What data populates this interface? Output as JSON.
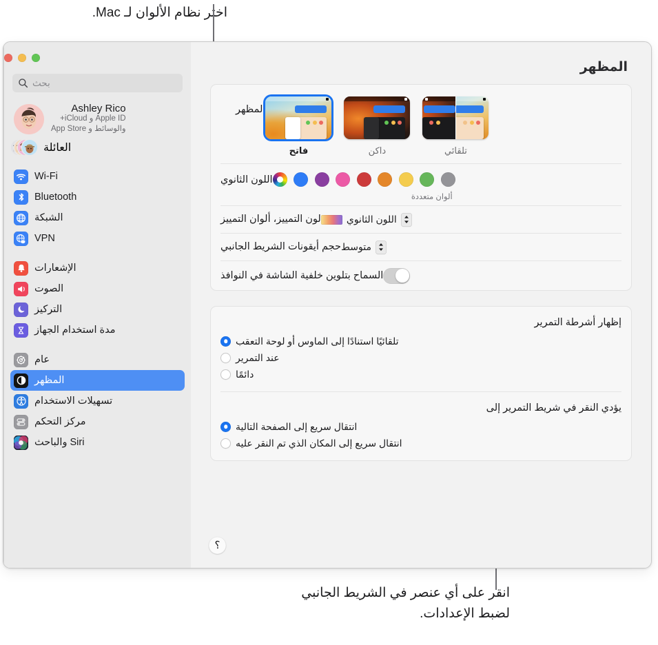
{
  "callouts": {
    "top": "اختر نظام الألوان لـ Mac.",
    "bottom": "انقر على أي عنصر في الشريط الجانبي لضبط الإعدادات."
  },
  "window": {
    "title": "المظهر",
    "traffic_lights": [
      "close",
      "minimize",
      "maximize"
    ]
  },
  "sidebar": {
    "search": {
      "placeholder": "بحث",
      "icon": "search-icon"
    },
    "account": {
      "name": "Ashley Rico",
      "subtitle_line1": "Apple ID و iCloud+",
      "subtitle_line2": "والوسائط و App Store",
      "avatar": "memoji-avatar"
    },
    "family": {
      "label": "العائلة",
      "icon": "family-avatars"
    },
    "groups": [
      {
        "items": [
          {
            "label": "Wi-Fi",
            "icon": "wifi-icon",
            "color": "#3b82f6",
            "selected": false
          },
          {
            "label": "Bluetooth",
            "icon": "bluetooth-icon",
            "color": "#3b82f6",
            "selected": false
          },
          {
            "label": "الشبكة",
            "icon": "globe-icon",
            "color": "#3b82f6",
            "selected": false
          },
          {
            "label": "VPN",
            "icon": "vpn-globe-icon",
            "color": "#3b82f6",
            "selected": false
          }
        ]
      },
      {
        "items": [
          {
            "label": "الإشعارات",
            "icon": "bell-icon",
            "color": "#f0503f",
            "selected": false
          },
          {
            "label": "الصوت",
            "icon": "speaker-icon",
            "color": "#f0455c",
            "selected": false
          },
          {
            "label": "التركيز",
            "icon": "moon-icon",
            "color": "#6c63d8",
            "selected": false
          },
          {
            "label": "مدة استخدام الجهاز",
            "icon": "hourglass-icon",
            "color": "#6b5de0",
            "selected": false
          }
        ]
      },
      {
        "items": [
          {
            "label": "عام",
            "icon": "gear-icon",
            "color": "#9a9a9e",
            "selected": false
          },
          {
            "label": "المظهر",
            "icon": "appearance-icon",
            "color": "#1a1a1a",
            "selected": true
          },
          {
            "label": "تسهيلات الاستخدام",
            "icon": "accessibility-icon",
            "color": "#2f7de0",
            "selected": false
          },
          {
            "label": "مركز التحكم",
            "icon": "control-center-icon",
            "color": "#9a9a9e",
            "selected": false
          },
          {
            "label": "Siri والباحث",
            "icon": "siri-icon",
            "color": "#25273a",
            "selected": false
          }
        ]
      }
    ]
  },
  "main": {
    "appearance_card": {
      "theme_row": {
        "label": "المظهر",
        "options": [
          {
            "caption": "فاتح",
            "value": "light",
            "selected": true
          },
          {
            "caption": "داكن",
            "value": "dark",
            "selected": false
          },
          {
            "caption": "تلقائي",
            "value": "auto",
            "selected": false
          }
        ]
      },
      "accent_row": {
        "label": "اللون الثانوي",
        "caption": "ألوان متعددة",
        "swatches": [
          {
            "name": "multicolor",
            "color": "wheel",
            "selected": true
          },
          {
            "name": "blue",
            "color": "#2e7cf6"
          },
          {
            "name": "purple",
            "color": "#8a3fa0"
          },
          {
            "name": "pink",
            "color": "#ec5aa6"
          },
          {
            "name": "red",
            "color": "#cc3b3b"
          },
          {
            "name": "orange",
            "color": "#e4872a"
          },
          {
            "name": "yellow",
            "color": "#f4cc4e"
          },
          {
            "name": "green",
            "color": "#66b65a"
          },
          {
            "name": "graphite",
            "color": "#949498"
          }
        ]
      },
      "highlight_row": {
        "label": "لون التمييز، ألوان التمييز",
        "value": "اللون الثانوي"
      },
      "sidebar_icon_row": {
        "label": "حجم أيقونات الشريط الجانبي",
        "value": "متوسط"
      },
      "wallpaper_tint_row": {
        "label": "السماح بتلوين خلفية الشاشة في النوافذ",
        "enabled": false
      }
    },
    "scroll_card": {
      "show_scrollbars": {
        "title": "إظهار أشرطة التمرير",
        "options": [
          {
            "label": "تلقائيًا استنادًا إلى الماوس أو لوحة التعقب",
            "selected": true
          },
          {
            "label": "عند التمرير",
            "selected": false
          },
          {
            "label": "دائمًا",
            "selected": false
          }
        ]
      },
      "click_scrollbar": {
        "title": "يؤدي النقر في شريط التمرير إلى",
        "options": [
          {
            "label": "انتقال سريع إلى الصفحة التالية",
            "selected": true
          },
          {
            "label": "انتقال سريع إلى المكان الذي تم النقر عليه",
            "selected": false
          }
        ]
      }
    },
    "help_button": {
      "label": "؟",
      "icon": "help-icon"
    }
  },
  "colors": {
    "accent": "#1a73f0",
    "selection": "#4e8ff4",
    "window_bg": "#f2f2f2",
    "sidebar_bg": "#eaeaea"
  }
}
